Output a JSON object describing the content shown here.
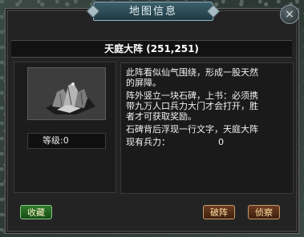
{
  "window": {
    "title": "地图信息",
    "close_label": "×"
  },
  "location": {
    "name_and_coords": "天庭大阵 (251,251)",
    "image_icon": "formation-stone-icon",
    "level_text": "等级:0"
  },
  "description": {
    "lines": [
      "此阵看似仙气围绕，形成一股天然",
      "的屏障。",
      "阵外竖立一块石碑，上书：必须携",
      "带九万人口兵力大门才会打开，胜",
      "者才可获取奖励。",
      "石碑背后浮现一行文字，天庭大阵",
      "现有兵力："
    ],
    "current_force": "0"
  },
  "buttons": {
    "collect": "收藏",
    "break_formation": "破阵",
    "scout": "侦察"
  },
  "colors": {
    "collect_button": "#2f7a2d",
    "action_button": "#6b3d22",
    "title_tab": "#3b5f6a"
  }
}
